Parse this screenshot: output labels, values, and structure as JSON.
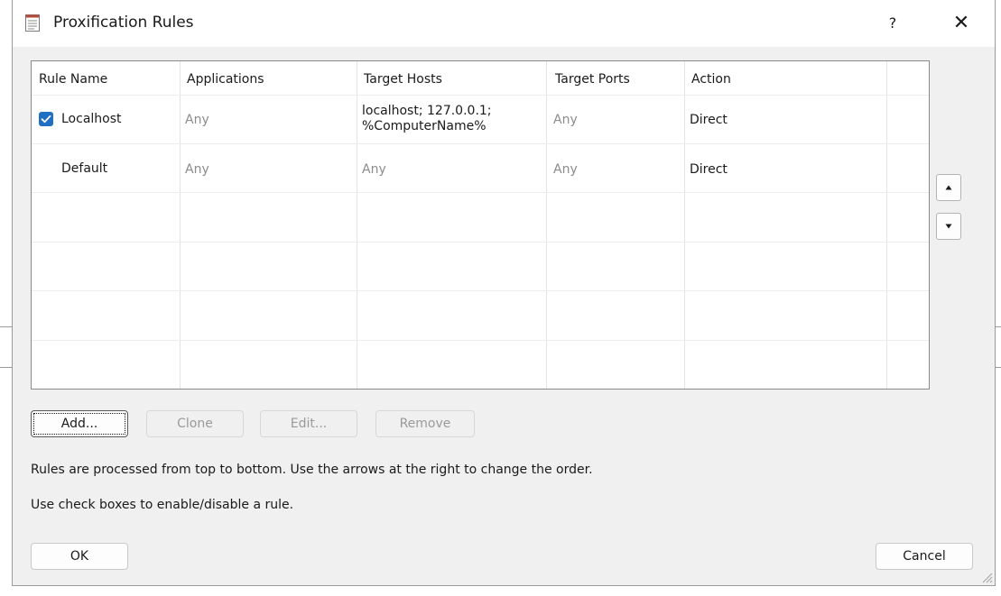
{
  "window": {
    "title": "Proxification Rules",
    "help_label": "?",
    "close_label": "✕"
  },
  "table": {
    "columns": [
      "Rule Name",
      "Applications",
      "Target Hosts",
      "Target Ports",
      "Action"
    ],
    "rows": [
      {
        "checked": true,
        "name": "Localhost",
        "applications": "Any",
        "target_hosts": "localhost; 127.0.0.1; %ComputerName%",
        "target_ports": "Any",
        "action": "Direct"
      },
      {
        "checked": false,
        "name": "Default",
        "applications": "Any",
        "target_hosts": "Any",
        "target_ports": "Any",
        "action": "Direct"
      }
    ]
  },
  "buttons": {
    "add": "Add...",
    "clone": "Clone",
    "edit": "Edit...",
    "remove": "Remove",
    "ok": "OK",
    "cancel": "Cancel"
  },
  "info": {
    "line1": "Rules are processed from top to bottom. Use the arrows at the right to change the order.",
    "line2": "Use check boxes to enable/disable a rule."
  },
  "icons": {
    "title": "rules-document-icon",
    "move_up": "triangle-up-icon",
    "move_down": "triangle-down-icon",
    "checkbox": "checkmark-icon",
    "resize": "resize-grip-icon"
  },
  "colors": {
    "checkbox_accent": "#1f6fc5",
    "dialog_bg": "#f0f0f0",
    "list_bg": "#ffffff",
    "disabled_text": "#9a9a9a"
  }
}
